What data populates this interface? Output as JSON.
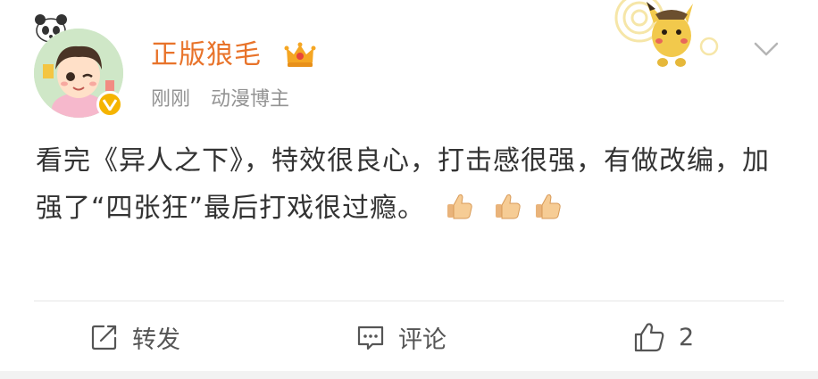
{
  "post": {
    "author": {
      "name": "正版狼毛",
      "time": "刚刚",
      "role": "动漫博主",
      "badge_icon": "crown-icon",
      "verified_icon": "verified-v-icon"
    },
    "text_part1": "看完《异人之下》，特效很良心，打击感很强，有做改编，加强了“四张狂”最后打戏很过瘾。",
    "emoji": "thumbs-up-icon",
    "emoji_count": 3
  },
  "actions": {
    "repost_label": "转发",
    "comment_label": "评论",
    "like_count": "2"
  },
  "colors": {
    "username": "#e8732a",
    "text": "#333333",
    "meta": "#939393",
    "verified": "#f5b400"
  }
}
